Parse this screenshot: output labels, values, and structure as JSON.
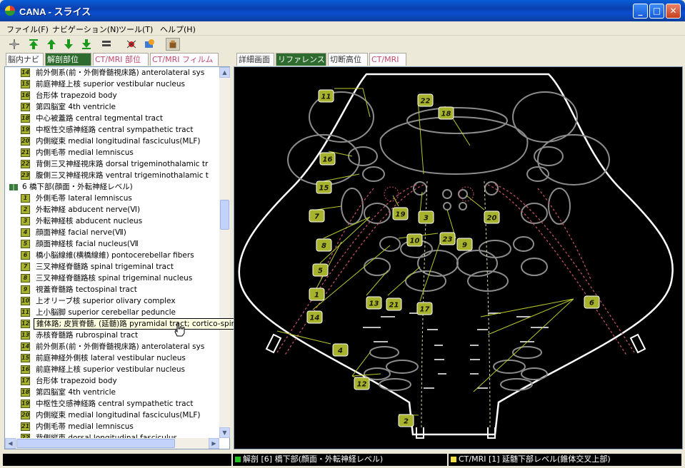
{
  "window": {
    "title": "CANA - スライス",
    "minimize": "_",
    "maximize": "□",
    "close": "✕"
  },
  "menu": [
    "ファイル(F)",
    "ナビゲーション(N)",
    "ツール(T)",
    "ヘルプ(H)"
  ],
  "left_tabs": [
    "脳内ナビ",
    "解剖部位",
    "CT/MRI 部位",
    "CT/MRI フィルム"
  ],
  "right_tabs": [
    "詳細画面",
    "リファレンス",
    "切断高位",
    "CT/MRI"
  ],
  "tree_rows": [
    {
      "num": "14",
      "text": "前外側系(前・外側脊髄視床路)  anterolateral sys"
    },
    {
      "num": "15",
      "text": "前庭神経上核  superior vestibular nucleus"
    },
    {
      "num": "16",
      "text": "台形体  trapezoid body"
    },
    {
      "num": "17",
      "text": "第四脳室  4th ventricle"
    },
    {
      "num": "18",
      "text": "中心被蓋路  central tegmental tract"
    },
    {
      "num": "19",
      "text": "中枢性交感神経路  central sympathetic tract"
    },
    {
      "num": "20",
      "text": "内側縦束  medial longitudinal fasciculus(MLF)"
    },
    {
      "num": "21",
      "text": "内側毛帯  medial lemniscus"
    },
    {
      "num": "22",
      "text": "背側三叉神経視床路  dorsal trigeminothalamic tr"
    },
    {
      "num": "23",
      "text": "腹側三叉神経視床路  ventral trigeminothalamic t"
    },
    {
      "num": "",
      "text": "6 橋下部(顔面・外転神経レベル)",
      "folder": true
    },
    {
      "num": "1",
      "text": "外側毛帯  lateral lemniscus"
    },
    {
      "num": "2",
      "text": "外転神経  abducent nerve(Ⅵ)"
    },
    {
      "num": "3",
      "text": "外転神経核  abducent nucleus"
    },
    {
      "num": "4",
      "text": "顔面神経  facial nerve(Ⅶ)"
    },
    {
      "num": "5",
      "text": "顔面神経核  facial nucleus(Ⅶ"
    },
    {
      "num": "6",
      "text": "橋小脳線維(横橋線維)  pontocerebellar fibers"
    },
    {
      "num": "7",
      "text": "三叉神経脊髄路  spinal trigeminal tract"
    },
    {
      "num": "8",
      "text": "三叉神経脊髄路核  spinal trigeminal nucleus"
    },
    {
      "num": "9",
      "text": "視蓋脊髄路  tectospinal tract"
    },
    {
      "num": "10",
      "text": "上オリーブ核  superior olivary complex"
    },
    {
      "num": "11",
      "text": "上小脳脚  superior cerebellar peduncle"
    },
    {
      "num": "12",
      "text": "錐体路; 皮質脊髄, (延髄)路  pyramidal tract; cortico-spinal, (bulbar) tract"
    },
    {
      "num": "13",
      "text": "赤核脊髄路  rubrospinal tract"
    },
    {
      "num": "14",
      "text": "前外側系(前・外側脊髄視床路)  anterolateral sys"
    },
    {
      "num": "15",
      "text": "前庭神経外側核  lateral vestibular nucleus"
    },
    {
      "num": "16",
      "text": "前庭神経上核  superior vestibular nucleus"
    },
    {
      "num": "17",
      "text": "台形体  trapezoid body"
    },
    {
      "num": "18",
      "text": "第四脳室  4th ventricle"
    },
    {
      "num": "19",
      "text": "中枢性交感神経路  central sympathetic tract"
    },
    {
      "num": "20",
      "text": "内側縦束  medial longitudinal fasciculus(MLF)"
    },
    {
      "num": "21",
      "text": "内側毛帯  medial lemniscus"
    },
    {
      "num": "22",
      "text": "背側縦束  dorsal longitudinal fasciculus"
    }
  ],
  "tooltip": "錐体路; 皮質脊髄, (延髄)路  pyramidal tract; cortico-spinal, (bulbar) tract",
  "diagram_labels": [
    {
      "num": "11"
    },
    {
      "num": "22"
    },
    {
      "num": "18"
    },
    {
      "num": "16"
    },
    {
      "num": "15"
    },
    {
      "num": "7"
    },
    {
      "num": "19"
    },
    {
      "num": "3"
    },
    {
      "num": "20"
    },
    {
      "num": "8"
    },
    {
      "num": "10"
    },
    {
      "num": "23"
    },
    {
      "num": "9"
    },
    {
      "num": "5"
    },
    {
      "num": "1"
    },
    {
      "num": "13"
    },
    {
      "num": "21"
    },
    {
      "num": "17"
    },
    {
      "num": "14"
    },
    {
      "num": "6"
    },
    {
      "num": "4"
    },
    {
      "num": "12"
    },
    {
      "num": "2"
    }
  ],
  "status": {
    "left": "解剖 [6] 橋下部(顔面・外転神経レベル)",
    "right": "CT/MRI [1] 延髄下部レベル(錐体交叉上部)"
  },
  "colors": {
    "label_fill": "#a7b22d",
    "active_tab": "#2e6b2e",
    "status_green": "#21c221",
    "status_yellow": "#f2e040"
  }
}
